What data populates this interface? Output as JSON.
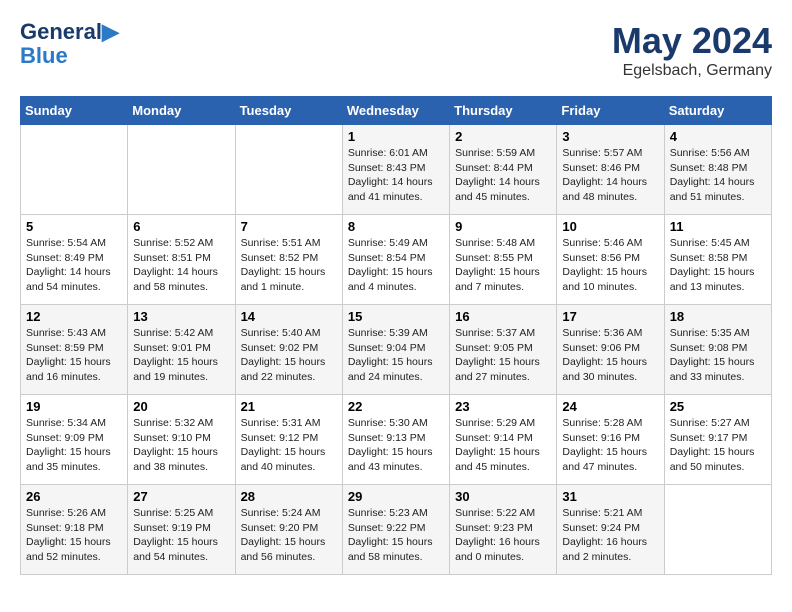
{
  "header": {
    "logo_line1": "General",
    "logo_line2": "Blue",
    "month": "May 2024",
    "location": "Egelsbach, Germany"
  },
  "days_of_week": [
    "Sunday",
    "Monday",
    "Tuesday",
    "Wednesday",
    "Thursday",
    "Friday",
    "Saturday"
  ],
  "weeks": [
    [
      {
        "day": "",
        "info": ""
      },
      {
        "day": "",
        "info": ""
      },
      {
        "day": "",
        "info": ""
      },
      {
        "day": "1",
        "info": "Sunrise: 6:01 AM\nSunset: 8:43 PM\nDaylight: 14 hours\nand 41 minutes."
      },
      {
        "day": "2",
        "info": "Sunrise: 5:59 AM\nSunset: 8:44 PM\nDaylight: 14 hours\nand 45 minutes."
      },
      {
        "day": "3",
        "info": "Sunrise: 5:57 AM\nSunset: 8:46 PM\nDaylight: 14 hours\nand 48 minutes."
      },
      {
        "day": "4",
        "info": "Sunrise: 5:56 AM\nSunset: 8:48 PM\nDaylight: 14 hours\nand 51 minutes."
      }
    ],
    [
      {
        "day": "5",
        "info": "Sunrise: 5:54 AM\nSunset: 8:49 PM\nDaylight: 14 hours\nand 54 minutes."
      },
      {
        "day": "6",
        "info": "Sunrise: 5:52 AM\nSunset: 8:51 PM\nDaylight: 14 hours\nand 58 minutes."
      },
      {
        "day": "7",
        "info": "Sunrise: 5:51 AM\nSunset: 8:52 PM\nDaylight: 15 hours\nand 1 minute."
      },
      {
        "day": "8",
        "info": "Sunrise: 5:49 AM\nSunset: 8:54 PM\nDaylight: 15 hours\nand 4 minutes."
      },
      {
        "day": "9",
        "info": "Sunrise: 5:48 AM\nSunset: 8:55 PM\nDaylight: 15 hours\nand 7 minutes."
      },
      {
        "day": "10",
        "info": "Sunrise: 5:46 AM\nSunset: 8:56 PM\nDaylight: 15 hours\nand 10 minutes."
      },
      {
        "day": "11",
        "info": "Sunrise: 5:45 AM\nSunset: 8:58 PM\nDaylight: 15 hours\nand 13 minutes."
      }
    ],
    [
      {
        "day": "12",
        "info": "Sunrise: 5:43 AM\nSunset: 8:59 PM\nDaylight: 15 hours\nand 16 minutes."
      },
      {
        "day": "13",
        "info": "Sunrise: 5:42 AM\nSunset: 9:01 PM\nDaylight: 15 hours\nand 19 minutes."
      },
      {
        "day": "14",
        "info": "Sunrise: 5:40 AM\nSunset: 9:02 PM\nDaylight: 15 hours\nand 22 minutes."
      },
      {
        "day": "15",
        "info": "Sunrise: 5:39 AM\nSunset: 9:04 PM\nDaylight: 15 hours\nand 24 minutes."
      },
      {
        "day": "16",
        "info": "Sunrise: 5:37 AM\nSunset: 9:05 PM\nDaylight: 15 hours\nand 27 minutes."
      },
      {
        "day": "17",
        "info": "Sunrise: 5:36 AM\nSunset: 9:06 PM\nDaylight: 15 hours\nand 30 minutes."
      },
      {
        "day": "18",
        "info": "Sunrise: 5:35 AM\nSunset: 9:08 PM\nDaylight: 15 hours\nand 33 minutes."
      }
    ],
    [
      {
        "day": "19",
        "info": "Sunrise: 5:34 AM\nSunset: 9:09 PM\nDaylight: 15 hours\nand 35 minutes."
      },
      {
        "day": "20",
        "info": "Sunrise: 5:32 AM\nSunset: 9:10 PM\nDaylight: 15 hours\nand 38 minutes."
      },
      {
        "day": "21",
        "info": "Sunrise: 5:31 AM\nSunset: 9:12 PM\nDaylight: 15 hours\nand 40 minutes."
      },
      {
        "day": "22",
        "info": "Sunrise: 5:30 AM\nSunset: 9:13 PM\nDaylight: 15 hours\nand 43 minutes."
      },
      {
        "day": "23",
        "info": "Sunrise: 5:29 AM\nSunset: 9:14 PM\nDaylight: 15 hours\nand 45 minutes."
      },
      {
        "day": "24",
        "info": "Sunrise: 5:28 AM\nSunset: 9:16 PM\nDaylight: 15 hours\nand 47 minutes."
      },
      {
        "day": "25",
        "info": "Sunrise: 5:27 AM\nSunset: 9:17 PM\nDaylight: 15 hours\nand 50 minutes."
      }
    ],
    [
      {
        "day": "26",
        "info": "Sunrise: 5:26 AM\nSunset: 9:18 PM\nDaylight: 15 hours\nand 52 minutes."
      },
      {
        "day": "27",
        "info": "Sunrise: 5:25 AM\nSunset: 9:19 PM\nDaylight: 15 hours\nand 54 minutes."
      },
      {
        "day": "28",
        "info": "Sunrise: 5:24 AM\nSunset: 9:20 PM\nDaylight: 15 hours\nand 56 minutes."
      },
      {
        "day": "29",
        "info": "Sunrise: 5:23 AM\nSunset: 9:22 PM\nDaylight: 15 hours\nand 58 minutes."
      },
      {
        "day": "30",
        "info": "Sunrise: 5:22 AM\nSunset: 9:23 PM\nDaylight: 16 hours\nand 0 minutes."
      },
      {
        "day": "31",
        "info": "Sunrise: 5:21 AM\nSunset: 9:24 PM\nDaylight: 16 hours\nand 2 minutes."
      },
      {
        "day": "",
        "info": ""
      }
    ]
  ]
}
